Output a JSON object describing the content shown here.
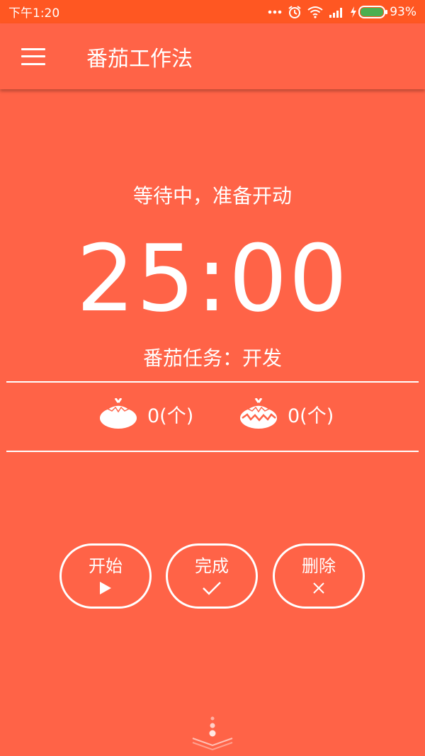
{
  "status_bar": {
    "time": "下午1:20",
    "battery_percent": "93%",
    "icons": [
      "more-dots-icon",
      "alarm-icon",
      "wifi-icon",
      "signal-icon",
      "charging-icon",
      "battery-icon"
    ]
  },
  "app_bar": {
    "title": "番茄工作法",
    "menu_icon": "hamburger-menu-icon"
  },
  "timer": {
    "state_text": "等待中，准备开动",
    "time_display": "25:00",
    "task_label": "番茄任务：",
    "task_value": "开发"
  },
  "counts": [
    {
      "icon": "tomato-icon",
      "value": "0(个)"
    },
    {
      "icon": "broken-tomato-icon",
      "value": "0(个)"
    }
  ],
  "actions": {
    "start_label": "开始",
    "done_label": "完成",
    "delete_label": "删除"
  },
  "colors": {
    "background": "#FF6347",
    "status_bar": "#FF5722",
    "foreground": "#FFFFFF",
    "battery_fill": "#4CAF50"
  }
}
